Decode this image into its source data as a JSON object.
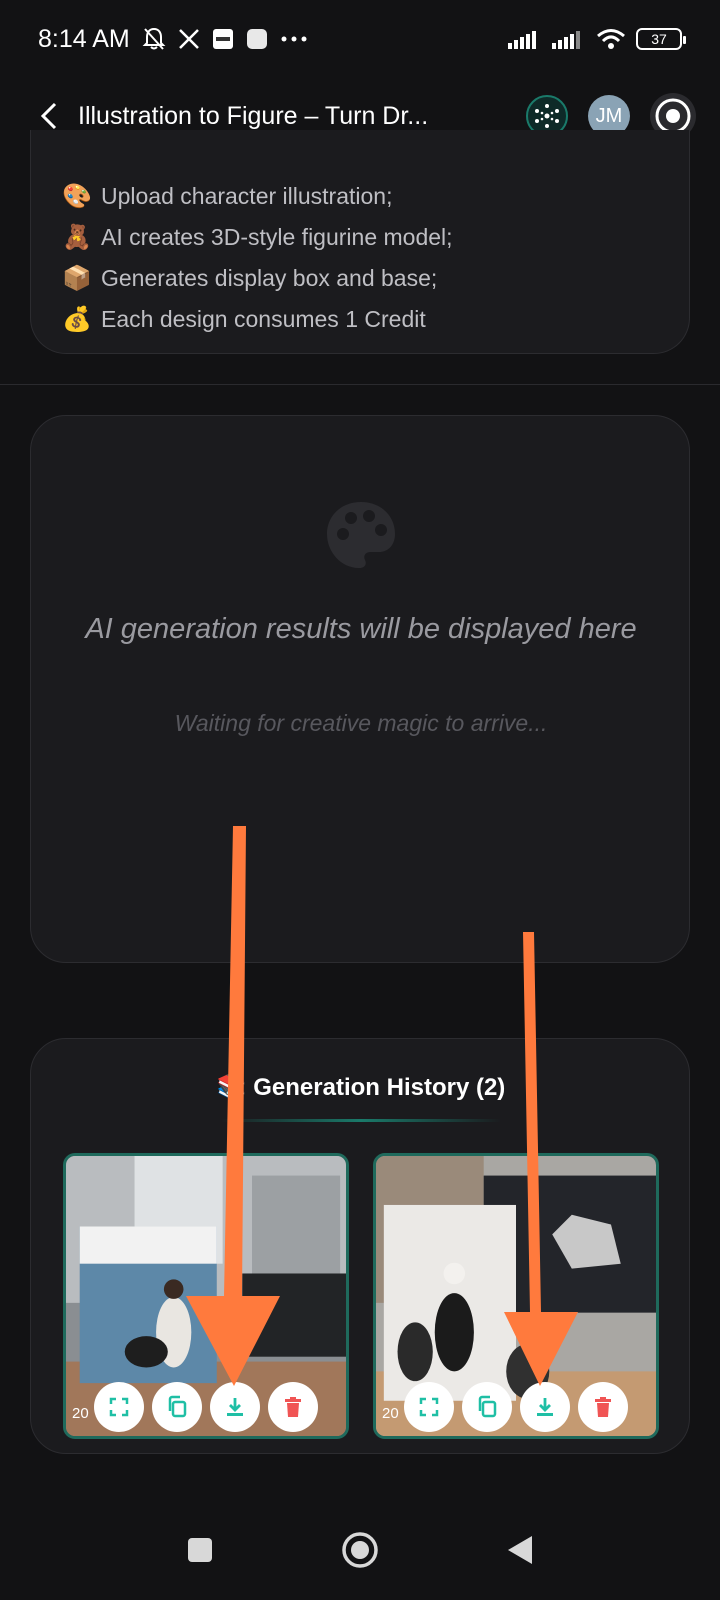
{
  "status_bar": {
    "time": "8:14 AM",
    "battery": "37"
  },
  "header": {
    "title": "Illustration to Figure – Turn Dr...",
    "avatar_initials": "JM"
  },
  "info": {
    "lines": [
      {
        "emoji": "🎨",
        "text": "Upload character illustration;"
      },
      {
        "emoji": "🧸",
        "text": "AI creates 3D-style figurine model;"
      },
      {
        "emoji": "📦",
        "text": "Generates display box and base;"
      },
      {
        "emoji": "💰",
        "text": "Each design consumes 1 Credit"
      }
    ]
  },
  "result": {
    "title": "AI generation results will be displayed here",
    "subtitle": "Waiting for creative magic to arrive..."
  },
  "history": {
    "emoji": "📚",
    "title": "Generation History (2)",
    "items": [
      {
        "date": "20"
      },
      {
        "date": "20"
      }
    ]
  },
  "colors": {
    "background": "#121214",
    "card": "#1b1b1e",
    "accent": "#1fbfa5",
    "danger": "#f05454",
    "arrow": "#ff7a3d"
  }
}
